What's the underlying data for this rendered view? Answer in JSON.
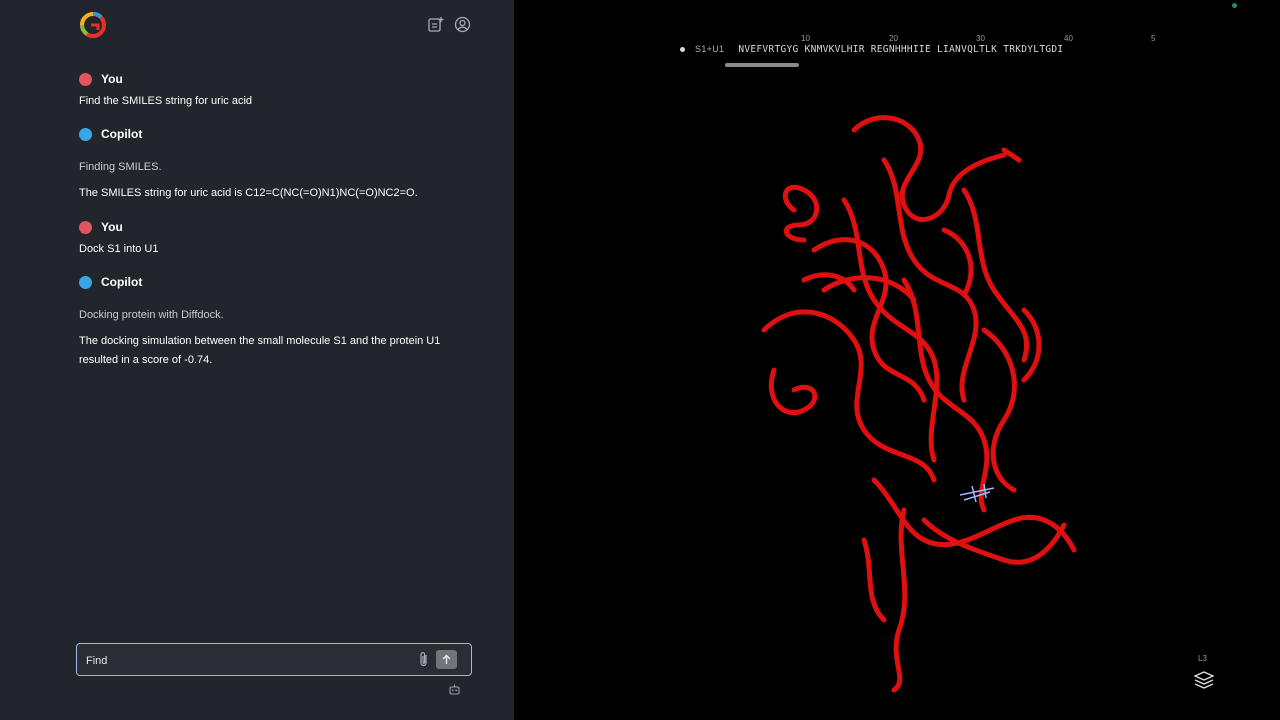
{
  "chat": {
    "messages": [
      {
        "sender": "You",
        "color": "#e0555f",
        "texts": [
          "Find the SMILES string for uric acid"
        ]
      },
      {
        "sender": "Copilot",
        "color": "#3aa6e6",
        "texts": [
          "Finding SMILES.",
          "The SMILES string for uric acid is C12=C(NC(=O)N1)NC(=O)NC2=O."
        ]
      },
      {
        "sender": "You",
        "color": "#e0555f",
        "texts": [
          "Dock S1 into U1"
        ]
      },
      {
        "sender": "Copilot",
        "color": "#3aa6e6",
        "texts": [
          "Docking protein with Diffdock.",
          "The docking simulation between the small molecule S1 and the protein U1 resulted in a score of -0.74."
        ]
      }
    ],
    "input_value": "Find",
    "icons": {
      "new_chat": "new-chat-icon",
      "account": "account-icon",
      "attach": "paperclip-icon",
      "send": "send-arrow-icon",
      "bottom": "bot-icon"
    }
  },
  "viewer": {
    "sequence_label": "S1+U1",
    "sequence": "NVEFVRTGYG KNMVKVLHIR REGNHHHIIE LIANVQLTLK TRKDYLTGDI",
    "ruler": [
      "10",
      "20",
      "30",
      "40",
      "5"
    ],
    "level_label": "L3",
    "protein_color": "#e01010",
    "icons": {
      "layers": "layers-icon"
    }
  }
}
